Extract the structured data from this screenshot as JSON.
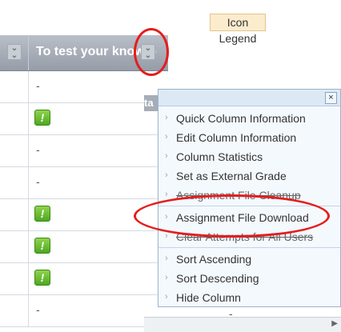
{
  "legend_button": "Icon Legend",
  "column_header": "To test your knowledge",
  "behind_header_fragment": "ta",
  "rows": [
    {
      "type": "dash",
      "text": "-"
    },
    {
      "type": "icon",
      "text": "!"
    },
    {
      "type": "dash",
      "text": "-"
    },
    {
      "type": "dash",
      "text": "-"
    },
    {
      "type": "icon",
      "text": "!"
    },
    {
      "type": "icon",
      "text": "!"
    },
    {
      "type": "icon",
      "text": "!"
    },
    {
      "type": "dash",
      "text": "-"
    }
  ],
  "menu": {
    "close": "×",
    "items": [
      "Quick Column Information",
      "Edit Column Information",
      "Column Statistics",
      "Set as External Grade",
      "Assignment File Cleanup",
      "Assignment File Download",
      "Clear Attempts for All Users",
      "Sort Ascending",
      "Sort Descending",
      "Hide Column"
    ]
  },
  "behind_dash": "-",
  "colors": {
    "highlight": "#e41d1d",
    "excl_green": "#4ea81e",
    "legend_bg": "#fbeccd"
  }
}
